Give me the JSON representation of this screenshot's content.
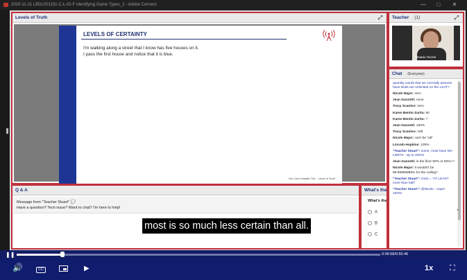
{
  "window": {
    "title": "2020-11-21 LBDL001151-C-L-IG-F Identifying Game Types_2 - Adobe Connect"
  },
  "slide_pod": {
    "title": "Levels of Truth",
    "slide": {
      "heading": "LEVELS OF CERTAINTY",
      "lines": [
        "I'm walking along a street that I know has five houses on it.",
        "I pass the first house and notice that it is blue."
      ],
      "footer": "You Can't Handle The... Level of Truth"
    }
  },
  "qa_pod": {
    "title": "Q & A",
    "message_from": "Message from \"Teacher Stuart\"",
    "message_text": "Have a question? Tech issue? Want to chat? I'm here to help!"
  },
  "poll_pod": {
    "title": "What's the",
    "question": "What's the",
    "options": [
      "A",
      "B",
      "C"
    ]
  },
  "teacher_pod": {
    "title": "Teacher",
    "count": "(1)",
    "presenter_name": "Melanie Tinchel"
  },
  "chat_pod": {
    "title": "Chat",
    "scope": "(Everyone)",
    "messages": [
      {
        "who": "",
        "text": "quantity words that we normally assume have limits are unlimited on the LSAT?",
        "blue": true
      },
      {
        "who": "Nicole Major:",
        "text": "zero",
        "blue": false
      },
      {
        "who": "Jean Gazzotti:",
        "text": "none",
        "blue": false
      },
      {
        "who": "Tracy Scanlon:",
        "text": "zero",
        "blue": false
      },
      {
        "who": "Karen Benito Zurita:",
        "text": "50",
        "blue": false
      },
      {
        "who": "Karen Benito Zurita:",
        "text": "?",
        "blue": false
      },
      {
        "who": "Jean Gazzotti:",
        "text": "100%",
        "blue": false
      },
      {
        "who": "Tracy Scanlon:",
        "text": "105",
        "blue": false
      },
      {
        "who": "Nicole Major:",
        "text": "can't be \"all\"",
        "blue": false
      },
      {
        "who": "Lincoln Hopkins:",
        "text": "100%",
        "blue": false
      },
      {
        "who": "\"Teacher Stuart\":",
        "text": "some, most have NO LIMITS - up to 100%!",
        "blue": true
      },
      {
        "who": "Jean Gazzotti:",
        "text": "is the floor 50% or 50%+?",
        "blue": false
      },
      {
        "who": "Nicole Major:",
        "text": "it wouldn't be 99.99999999% for the ceiling?",
        "blue": false
      },
      {
        "who": "\"Teacher Stuart\":",
        "text": "most = \"AT LEAST more than half\"",
        "blue": true
      },
      {
        "who": "\"Teacher Stuart\":",
        "text": "@Nicole - nope! 100%!",
        "blue": true
      }
    ]
  },
  "caption": "most is so much less certain than all.",
  "player": {
    "time": "0:06:58/0:55:46",
    "progress": 0.125,
    "speed": "1x",
    "cc_label": "CC"
  },
  "icons": [
    "pause-icon",
    "volume-icon",
    "closed-captions-icon",
    "picture-in-picture-icon",
    "play-icon",
    "fullscreen-icon",
    "broadcast-icon"
  ]
}
